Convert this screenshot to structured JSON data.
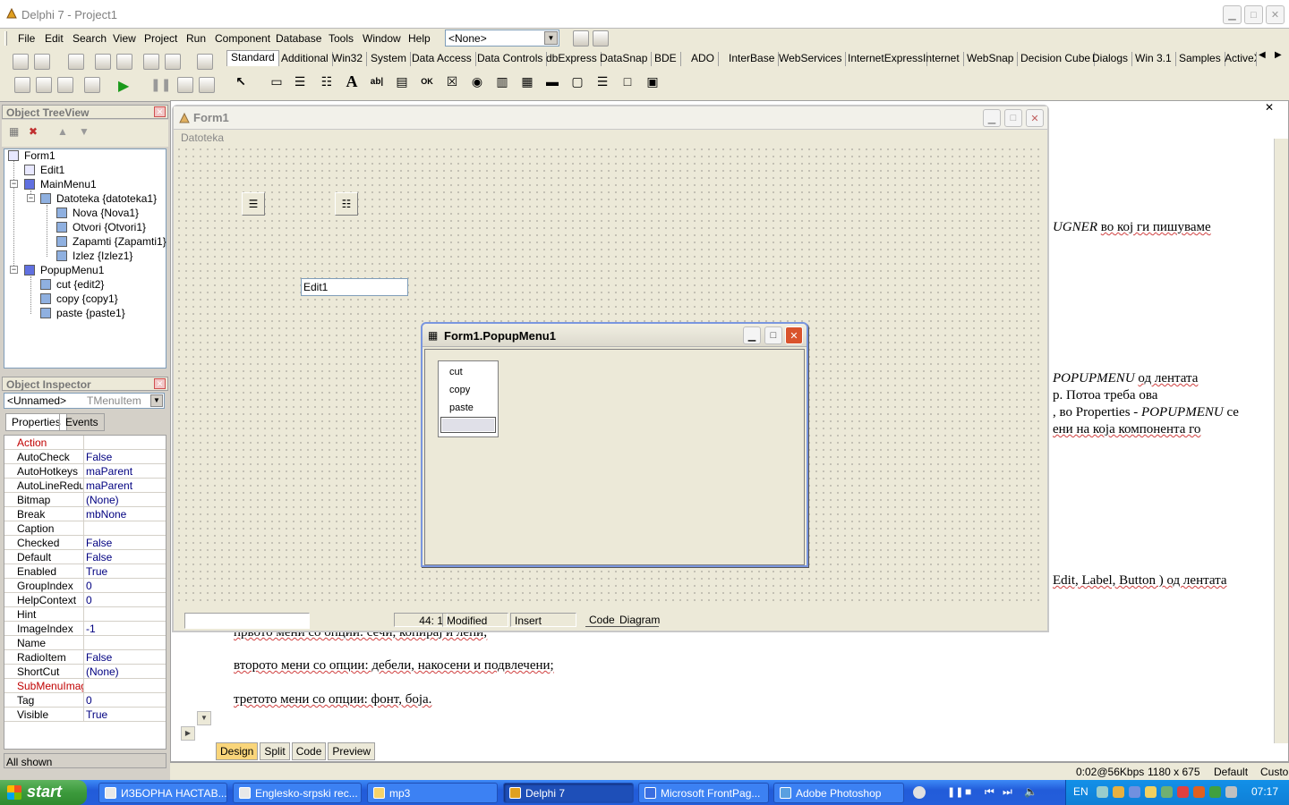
{
  "ide": {
    "title": "Delphi 7 - Project1",
    "menu": [
      "File",
      "Edit",
      "Search",
      "View",
      "Project",
      "Run",
      "Component",
      "Database",
      "Tools",
      "Window",
      "Help"
    ],
    "config_combo": "<None>"
  },
  "palette": {
    "tabs": [
      "Standard",
      "Additional",
      "Win32",
      "System",
      "Data Access",
      "Data Controls",
      "dbExpress",
      "DataSnap",
      "BDE",
      "ADO",
      "InterBase",
      "WebServices",
      "InternetExpress",
      "Internet",
      "WebSnap",
      "Decision Cube",
      "Dialogs",
      "Win 3.1",
      "Samples",
      "ActiveX"
    ],
    "active_tab": "Standard"
  },
  "treeview": {
    "title": "Object TreeView",
    "nodes": [
      "Form1",
      "Edit1",
      "MainMenu1",
      "Datoteka {datoteka1}",
      "Nova {Nova1}",
      "Otvori {Otvori1}",
      "Zapamti {Zapamti1}",
      "Izlez {Izlez1}",
      "PopupMenu1",
      "cut {edit2}",
      "copy {copy1}",
      "paste {paste1}"
    ]
  },
  "inspector": {
    "title": "Object Inspector",
    "object_name": "<Unnamed>",
    "object_class": "TMenuItem",
    "tabs": [
      "Properties",
      "Events"
    ],
    "properties": [
      {
        "name": "Action",
        "value": ""
      },
      {
        "name": "AutoCheck",
        "value": "False"
      },
      {
        "name": "AutoHotkeys",
        "value": "maParent"
      },
      {
        "name": "AutoLineReduction",
        "value": "maParent"
      },
      {
        "name": "Bitmap",
        "value": "(None)"
      },
      {
        "name": "Break",
        "value": "mbNone"
      },
      {
        "name": "Caption",
        "value": ""
      },
      {
        "name": "Checked",
        "value": "False"
      },
      {
        "name": "Default",
        "value": "False"
      },
      {
        "name": "Enabled",
        "value": "True"
      },
      {
        "name": "GroupIndex",
        "value": "0"
      },
      {
        "name": "HelpContext",
        "value": "0"
      },
      {
        "name": "Hint",
        "value": ""
      },
      {
        "name": "ImageIndex",
        "value": "-1"
      },
      {
        "name": "Name",
        "value": ""
      },
      {
        "name": "RadioItem",
        "value": "False"
      },
      {
        "name": "ShortCut",
        "value": "(None)"
      },
      {
        "name": "SubMenuImages",
        "value": ""
      },
      {
        "name": "Tag",
        "value": "0"
      },
      {
        "name": "Visible",
        "value": "True"
      }
    ],
    "status": "All shown"
  },
  "form1": {
    "title": "Form1",
    "menu_caption": "Datoteka",
    "edit_text": "Edit1",
    "status": {
      "position": "44:  1",
      "modified": "Modified",
      "mode": "Insert",
      "tab_code": "Code",
      "tab_diagram": "Diagram"
    }
  },
  "popup_editor": {
    "title": "Form1.PopupMenu1",
    "items": [
      "cut",
      "copy",
      "paste"
    ]
  },
  "document": {
    "line1_italic": "UGNER",
    "line1_rest": "во кој ги пишуваме",
    "line2_italic": "POPUPMENU",
    "line2_rest": "од лентата",
    "line3": "р.  Потоа треба ова",
    "line4_a": ", во Properties - ",
    "line4_italic": "POPUPMENU",
    "line4_b": " се",
    "line5": "ени на која компонента го",
    "line6": "Edit, Label, Button ) од лентата",
    "line7": "првото мени со опции: сечи, копирај и лепи;",
    "line8": "второто мени со опции: дебели, накосени и подвлечени;",
    "line9": "третото мени со опции:  фонт, боја."
  },
  "editor_tabs": [
    "Design",
    "Split",
    "Code",
    "Preview"
  ],
  "status_bar": {
    "speed": "0:02@56Kbps",
    "size": "1180 x 675",
    "default": "Default",
    "custom": "Custom"
  },
  "taskbar": {
    "start": "start",
    "buttons": [
      "ИЗБОРНА НАСТАВ...",
      "Englesko-srpski rec...",
      "mp3",
      "Delphi 7",
      "Microsoft FrontPag...",
      "Adobe Photoshop"
    ],
    "lang": "EN",
    "clock": "07:17"
  }
}
